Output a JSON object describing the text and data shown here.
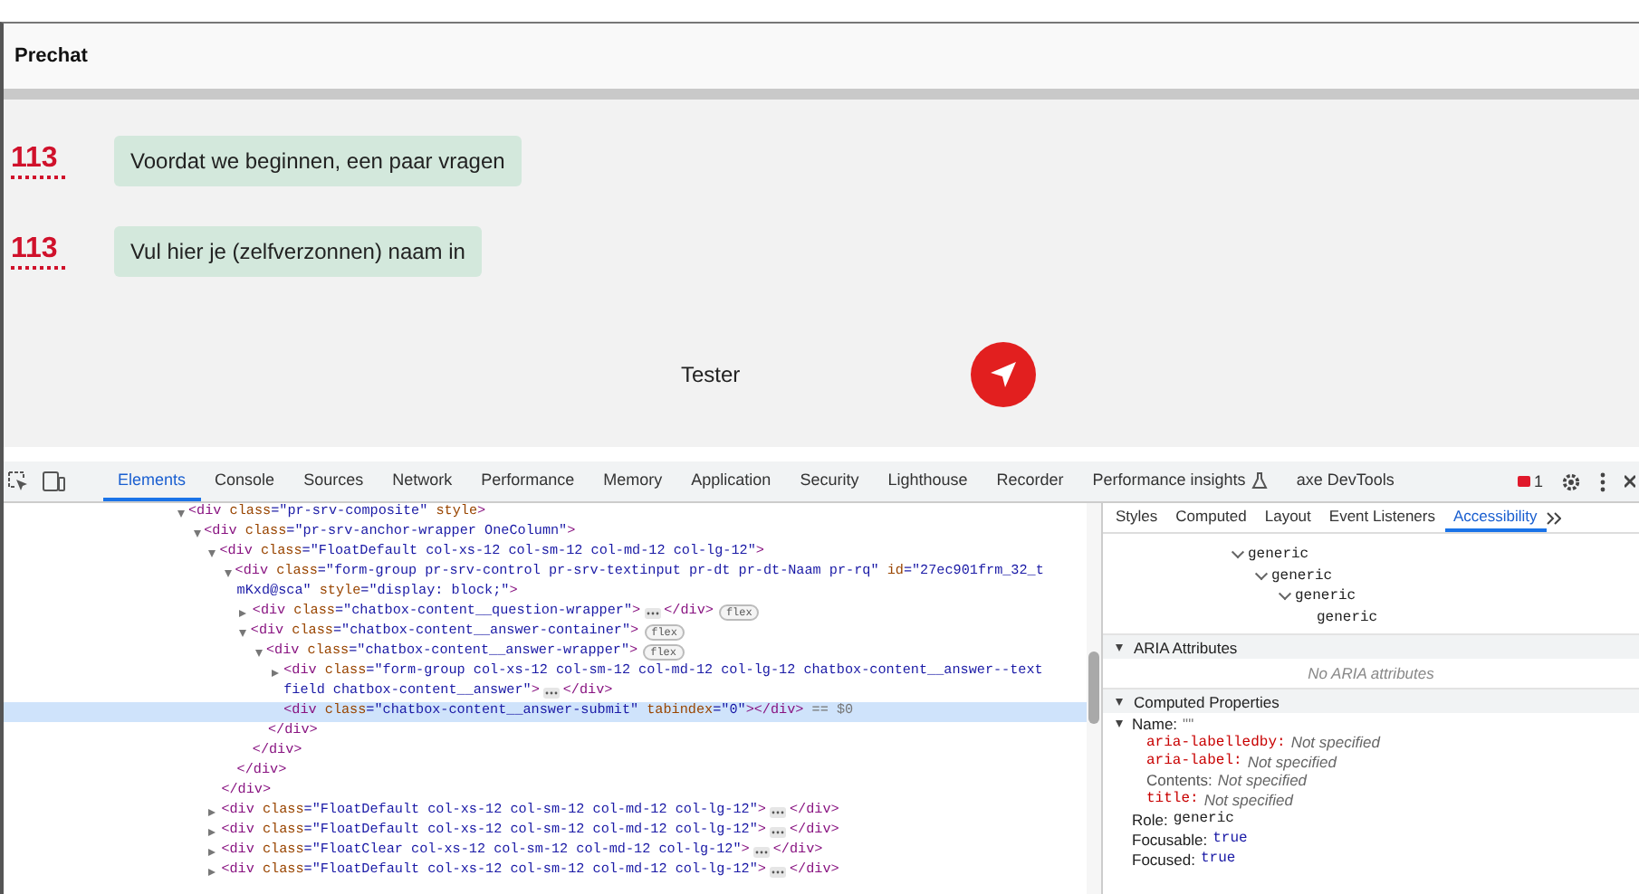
{
  "chat": {
    "title": "Prechat",
    "messages": [
      {
        "avatar": "113",
        "text": "Voordat we beginnen, een paar vragen"
      },
      {
        "avatar": "113",
        "text": "Vul hier je (zelfverzonnen) naam in"
      }
    ],
    "answer_field": {
      "value": "Tester"
    }
  },
  "devtools": {
    "tabs": [
      {
        "label": "Elements",
        "selected": true,
        "kind": "plain"
      },
      {
        "label": "Console",
        "selected": false,
        "kind": "plain"
      },
      {
        "label": "Sources",
        "selected": false,
        "kind": "plain"
      },
      {
        "label": "Network",
        "selected": false,
        "kind": "plain"
      },
      {
        "label": "Performance",
        "selected": false,
        "kind": "plain"
      },
      {
        "label": "Memory",
        "selected": false,
        "kind": "plain"
      },
      {
        "label": "Application",
        "selected": false,
        "kind": "plain"
      },
      {
        "label": "Security",
        "selected": false,
        "kind": "plain"
      },
      {
        "label": "Lighthouse",
        "selected": false,
        "kind": "plain"
      },
      {
        "label": "Recorder",
        "selected": false,
        "kind": "plain"
      },
      {
        "label": "Performance insights",
        "selected": false,
        "kind": "experimental"
      },
      {
        "label": "axe DevTools",
        "selected": false,
        "kind": "plain"
      }
    ],
    "issues_count": "1",
    "dom": [
      {
        "selected": false,
        "expanded": true,
        "open": [
          {
            "kind": "tag",
            "text": "<div"
          },
          {
            "kind": "attr",
            "text": " class"
          },
          {
            "kind": "value",
            "text": "=\"pr-srv-composite\""
          },
          {
            "kind": "attr",
            "text": " style"
          },
          {
            "kind": "tag",
            "text": ">"
          }
        ],
        "children": [
          {
            "selected": false,
            "expanded": true,
            "open": [
              {
                "kind": "tag",
                "text": "<div"
              },
              {
                "kind": "attr",
                "text": " class"
              },
              {
                "kind": "value",
                "text": "=\"pr-srv-anchor-wrapper OneColumn\""
              },
              {
                "kind": "tag",
                "text": ">"
              }
            ],
            "children": [
              {
                "selected": false,
                "expanded": true,
                "open": [
                  {
                    "kind": "tag",
                    "text": "<div"
                  },
                  {
                    "kind": "attr",
                    "text": " class"
                  },
                  {
                    "kind": "value",
                    "text": "=\"FloatDefault col-xs-12 col-sm-12 col-md-12 col-lg-12\""
                  },
                  {
                    "kind": "tag",
                    "text": ">"
                  }
                ],
                "close": "</div>",
                "children": [
                  {
                    "selected": false,
                    "expanded": true,
                    "open": [
                      {
                        "kind": "tag",
                        "text": "<div"
                      },
                      {
                        "kind": "attr",
                        "text": " class"
                      },
                      {
                        "kind": "value",
                        "text": "=\"form-group pr-srv-control pr-srv-textinput pr-dt pr-dt-Naam pr-rq\""
                      },
                      {
                        "kind": "attr",
                        "text": " id"
                      },
                      {
                        "kind": "value",
                        "text": "=\"27ec901frm_32_t"
                      }
                    ],
                    "wrap": [
                      {
                        "kind": "value",
                        "text": "mKxd@sca\""
                      },
                      {
                        "kind": "attr",
                        "text": " style"
                      },
                      {
                        "kind": "value",
                        "text": "=\"display: block;\""
                      },
                      {
                        "kind": "tag",
                        "text": ">"
                      }
                    ],
                    "close": "</div>",
                    "children": [
                      {
                        "selected": false,
                        "expanded": false,
                        "open": [
                          {
                            "kind": "tag",
                            "text": "<div"
                          },
                          {
                            "kind": "attr",
                            "text": " class"
                          },
                          {
                            "kind": "value",
                            "text": "=\"chatbox-content__question-wrapper\""
                          },
                          {
                            "kind": "tag",
                            "text": ">"
                          }
                        ],
                        "tail": "</div>",
                        "badge": "flex"
                      },
                      {
                        "selected": false,
                        "expanded": true,
                        "open": [
                          {
                            "kind": "tag",
                            "text": "<div"
                          },
                          {
                            "kind": "attr",
                            "text": " class"
                          },
                          {
                            "kind": "value",
                            "text": "=\"chatbox-content__answer-container\""
                          },
                          {
                            "kind": "tag",
                            "text": ">"
                          }
                        ],
                        "badge": "flex",
                        "close": "</div>",
                        "children": [
                          {
                            "selected": false,
                            "expanded": true,
                            "open": [
                              {
                                "kind": "tag",
                                "text": "<div"
                              },
                              {
                                "kind": "attr",
                                "text": " class"
                              },
                              {
                                "kind": "value",
                                "text": "=\"chatbox-content__answer-wrapper\""
                              },
                              {
                                "kind": "tag",
                                "text": ">"
                              }
                            ],
                            "badge": "flex",
                            "close": "</div>",
                            "children": [
                              {
                                "selected": false,
                                "expanded": false,
                                "open": [
                                  {
                                    "kind": "tag",
                                    "text": "<div"
                                  },
                                  {
                                    "kind": "attr",
                                    "text": " class"
                                  },
                                  {
                                    "kind": "value",
                                    "text": "=\"form-group col-xs-12 col-sm-12 col-md-12 col-lg-12 chatbox-content__answer--text"
                                  }
                                ],
                                "wrap": [
                                  {
                                    "kind": "value",
                                    "text": "field chatbox-content__answer\""
                                  },
                                  {
                                    "kind": "tag",
                                    "text": ">"
                                  }
                                ],
                                "tail": "</div>"
                              },
                              {
                                "selected": true,
                                "open": [
                                  {
                                    "kind": "tag",
                                    "text": "<div"
                                  },
                                  {
                                    "kind": "attr",
                                    "text": " class"
                                  },
                                  {
                                    "kind": "value",
                                    "text": "=\"chatbox-content__answer-submit\""
                                  },
                                  {
                                    "kind": "attr",
                                    "text": " tabindex"
                                  },
                                  {
                                    "kind": "value",
                                    "text": "=\"0\""
                                  },
                                  {
                                    "kind": "tag",
                                    "text": "></div>"
                                  },
                                  {
                                    "kind": "note",
                                    "text": " == $0"
                                  }
                                ]
                              }
                            ]
                          }
                        ]
                      }
                    ]
                  }
                ]
              },
              {
                "selected": false,
                "expanded": false,
                "open": [
                  {
                    "kind": "tag",
                    "text": "<div"
                  },
                  {
                    "kind": "attr",
                    "text": " class"
                  },
                  {
                    "kind": "value",
                    "text": "=\"FloatDefault col-xs-12 col-sm-12 col-md-12 col-lg-12\""
                  },
                  {
                    "kind": "tag",
                    "text": ">"
                  }
                ],
                "tail": "</div>"
              },
              {
                "selected": false,
                "expanded": false,
                "open": [
                  {
                    "kind": "tag",
                    "text": "<div"
                  },
                  {
                    "kind": "attr",
                    "text": " class"
                  },
                  {
                    "kind": "value",
                    "text": "=\"FloatDefault col-xs-12 col-sm-12 col-md-12 col-lg-12\""
                  },
                  {
                    "kind": "tag",
                    "text": ">"
                  }
                ],
                "tail": "</div>"
              },
              {
                "selected": false,
                "expanded": false,
                "open": [
                  {
                    "kind": "tag",
                    "text": "<div"
                  },
                  {
                    "kind": "attr",
                    "text": " class"
                  },
                  {
                    "kind": "value",
                    "text": "=\"FloatClear col-xs-12 col-sm-12 col-md-12 col-lg-12\""
                  },
                  {
                    "kind": "tag",
                    "text": ">"
                  }
                ],
                "tail": "</div>"
              },
              {
                "selected": false,
                "expanded": false,
                "open": [
                  {
                    "kind": "tag",
                    "text": "<div"
                  },
                  {
                    "kind": "attr",
                    "text": " class"
                  },
                  {
                    "kind": "value",
                    "text": "=\"FloatDefault col-xs-12 col-sm-12 col-md-12 col-lg-12\""
                  },
                  {
                    "kind": "tag",
                    "text": ">"
                  }
                ],
                "tail": "</div>"
              }
            ]
          }
        ]
      }
    ],
    "side_tabs": [
      {
        "label": "Styles",
        "selected": false
      },
      {
        "label": "Computed",
        "selected": false
      },
      {
        "label": "Layout",
        "selected": false
      },
      {
        "label": "Event Listeners",
        "selected": false
      },
      {
        "label": "Accessibility",
        "selected": true
      }
    ],
    "a11y_tree": [
      {
        "label": "generic",
        "expanded": true,
        "children": [
          {
            "label": "generic",
            "expanded": true,
            "children": [
              {
                "label": "generic",
                "expanded": true,
                "children": [
                  {
                    "label": "generic"
                  }
                ]
              }
            ]
          }
        ]
      }
    ],
    "sections": [
      {
        "title": "ARIA Attributes",
        "expanded": true,
        "empty_note": "No ARIA attributes"
      },
      {
        "title": "Computed Properties",
        "expanded": true,
        "properties": [
          {
            "name": "Name:",
            "value": "\"\"",
            "kind": "string",
            "expanded": true,
            "sources": [
              {
                "name": "aria-labelledby:",
                "value": "Not specified",
                "kind": "attribute"
              },
              {
                "name": "aria-label:",
                "value": "Not specified",
                "kind": "attribute"
              },
              {
                "name": "Contents:",
                "value": "Not specified",
                "kind": "content"
              },
              {
                "name": "title:",
                "value": "Not specified",
                "kind": "attribute"
              }
            ]
          },
          {
            "name": "Role:",
            "value": "generic",
            "kind": "token"
          },
          {
            "name": "Focusable:",
            "value": "true",
            "kind": "boolean"
          },
          {
            "name": "Focused:",
            "value": "true",
            "kind": "boolean"
          }
        ]
      }
    ]
  }
}
